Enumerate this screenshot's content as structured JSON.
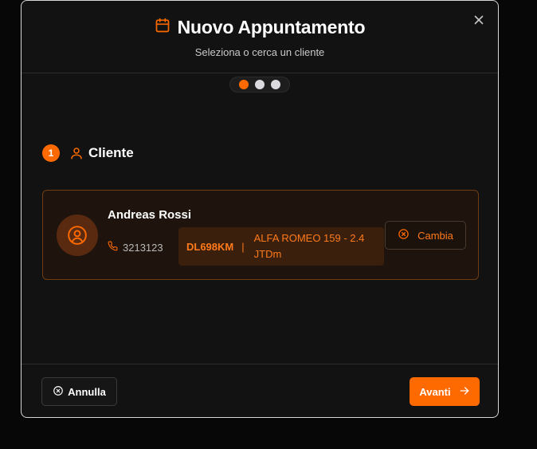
{
  "header": {
    "title": "Nuovo Appuntamento",
    "subtitle": "Seleziona o cerca un cliente",
    "title_icon": "calendar-icon"
  },
  "steps": {
    "total": 3,
    "current": 1
  },
  "section": {
    "number": "1",
    "title": "Cliente",
    "icon": "user-icon"
  },
  "client": {
    "name": "Andreas Rossi",
    "phone": "3213123",
    "plate": "DL698KM",
    "separator": "|",
    "vehicle_model": "ALFA ROMEO 159 - 2.4 JTDm",
    "change_label": "Cambia"
  },
  "footer": {
    "cancel_label": "Annulla",
    "next_label": "Avanti"
  },
  "colors": {
    "accent": "#ff6a00",
    "background": "#121212",
    "card_border": "#6e3c15"
  }
}
